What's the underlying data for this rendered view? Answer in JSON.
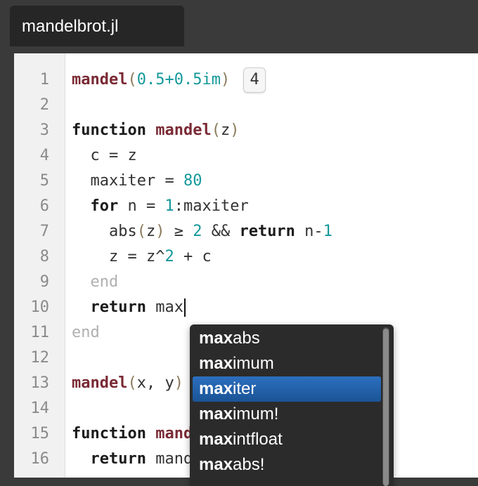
{
  "tab": {
    "title": "mandelbrot.jl"
  },
  "line_numbers": [
    "1",
    "2",
    "3",
    "4",
    "5",
    "6",
    "7",
    "8",
    "9",
    "10",
    "11",
    "12",
    "13",
    "14",
    "15",
    "16"
  ],
  "code": {
    "l1": {
      "fn": "mandel",
      "open": "(",
      "args": "0.5+0.5im",
      "close": ")",
      "result": "4"
    },
    "l3": {
      "kw": "function",
      "fn": "mandel",
      "open": "(",
      "arg": "z",
      "close": ")"
    },
    "l4": {
      "text": "  c = z"
    },
    "l5": {
      "pre": "  maxiter = ",
      "num": "80"
    },
    "l6": {
      "pre": "  ",
      "kw": "for",
      "mid": " n = ",
      "num": "1",
      "post": ":maxiter"
    },
    "l7": {
      "pre": "    abs",
      "open": "(",
      "arg": "z",
      "close": ")",
      "op": " ≥ ",
      "num": "2",
      "and": " && ",
      "kw": "return",
      "mid": " n-",
      "num2": "1"
    },
    "l8": {
      "pre": "    z = z^",
      "num": "2",
      "post": " + c"
    },
    "l9": {
      "pre": "  ",
      "kw": "end"
    },
    "l10": {
      "pre": "  ",
      "kw": "return",
      "post": " max"
    },
    "l11": {
      "kw": "end"
    },
    "l13": {
      "fn": "mandel",
      "open": "(",
      "args": "x, y",
      "close": ")"
    },
    "l15": {
      "kw": "function",
      "fn": "mandel"
    },
    "l16": {
      "pre": "  ",
      "kw": "return",
      "post": " mandel(x + y*im)"
    }
  },
  "autocomplete": {
    "items": [
      {
        "match": "max",
        "rest": "abs"
      },
      {
        "match": "max",
        "rest": "imum"
      },
      {
        "match": "max",
        "rest": "iter"
      },
      {
        "match": "max",
        "rest": "imum!"
      },
      {
        "match": "max",
        "rest": "intfloat"
      },
      {
        "match": "max",
        "rest": "abs!"
      }
    ],
    "selected_index": 2
  },
  "colors": {
    "function_name": "#7a2b35",
    "number": "#14989a",
    "selection": "#2c6fbf"
  }
}
